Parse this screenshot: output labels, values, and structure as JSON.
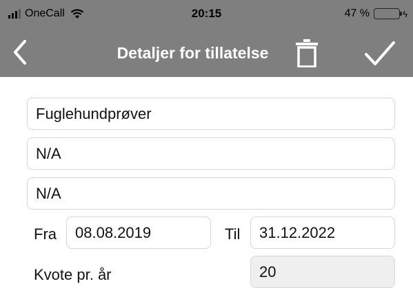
{
  "status_bar": {
    "carrier": "OneCall",
    "time": "20:15",
    "battery": "47 %",
    "battery_level": 0.47,
    "battery_color": "#34c759"
  },
  "nav": {
    "title": "Detaljer for tillatelse",
    "back_icon": "chevron-left-icon",
    "trash_icon": "trash-icon",
    "save_icon": "checkmark-icon",
    "bar_color": "#7f7f7f"
  },
  "form": {
    "name_value": "Fuglehundprøver",
    "field2_value": "N/A",
    "field3_value": "N/A",
    "from_label": "Fra",
    "from_value": "08.08.2019",
    "to_label": "Til",
    "to_value": "31.12.2022",
    "quota_label": "Kvote pr. år",
    "quota_value": "20"
  }
}
